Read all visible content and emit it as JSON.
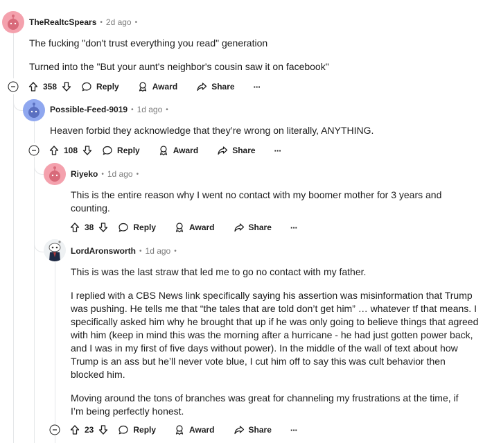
{
  "comments": [
    {
      "username": "TheRealtcSpears",
      "time": "2d ago",
      "paragraphs": [
        "The fucking \"don't trust everything you read\" generation",
        "Turned into the \"But your aunt's neighbor's cousin saw it on facebook\""
      ],
      "score": "358"
    },
    {
      "username": "Possible-Feed-9019",
      "time": "1d ago",
      "paragraphs": [
        "Heaven forbid they acknowledge that they’re wrong on literally, ANYTHING."
      ],
      "score": "108"
    },
    {
      "username": "Riyeko",
      "time": "1d ago",
      "paragraphs": [
        "This is the entire reason why I went no contact with my boomer mother for 3 years and counting."
      ],
      "score": "38"
    },
    {
      "username": "LordAronsworth",
      "time": "1d ago",
      "paragraphs": [
        "This is was the last straw that led me to go no contact with my father.",
        "I replied with a CBS News link specifically saying his assertion was misinformation that Trump was pushing. He tells me that “the tales that are told don’t get him” … whatever tf that means. I specifically asked him why he brought that up if he was only going to believe things that agreed with him (keep in mind this was the morning after a hurricane - he had just gotten power back, and I was in my first of five days without power). In the middle of the wall of text about how Trump is an ass but he’ll never vote blue, I cut him off to say this was cult behavior then blocked him.",
        "Moving around the tons of branches was great for channeling my frustrations at the time, if I’m being perfectly honest."
      ],
      "score": "23"
    }
  ],
  "actions": {
    "reply": "Reply",
    "award": "Award",
    "share": "Share",
    "more": "···"
  },
  "meta_separator": "•",
  "colors": {
    "avatar_pink": "#f4a1ad",
    "avatar_blue": "#8fa7ef",
    "thread_line": "#e5e7e9",
    "meta_gray": "#7c7c7c"
  }
}
